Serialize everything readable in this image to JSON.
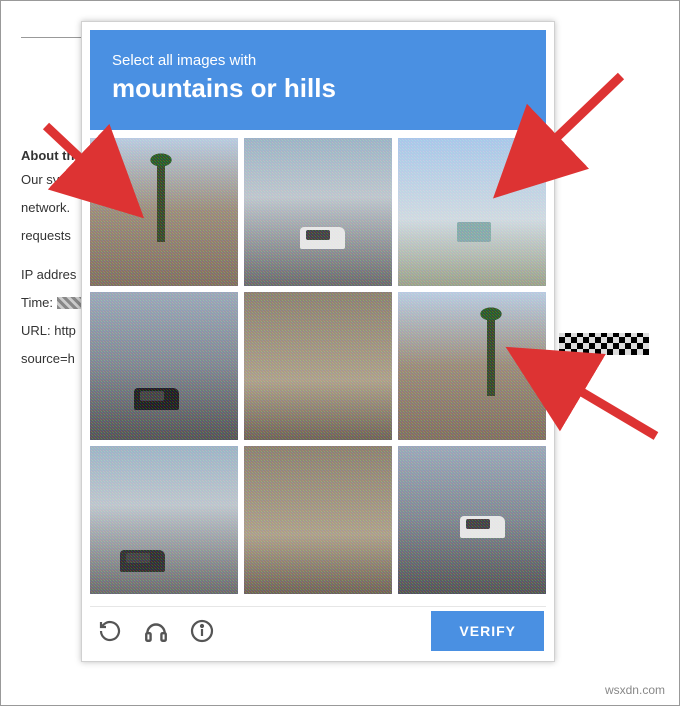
{
  "page": {
    "about_heading": "About th",
    "para1": "Our syste",
    "para2": "network.",
    "para3": "requests",
    "ip_label": "IP addres",
    "time_label": "Time:",
    "url_label": "URL: http",
    "source_label": "source=h"
  },
  "captcha": {
    "instruction_line1": "Select all images with",
    "instruction_line2": "mountains or hills",
    "verify_label": "VERIFY",
    "tiles": [
      "hills-with-palm-and-truck",
      "road-with-white-car",
      "highway-with-hills",
      "street-with-black-suv",
      "building-with-traffic-light",
      "mountains-with-palm",
      "road-with-car",
      "building-fire-escape",
      "street-with-white-car-crosswalk"
    ]
  },
  "watermark": "wsxdn.com"
}
